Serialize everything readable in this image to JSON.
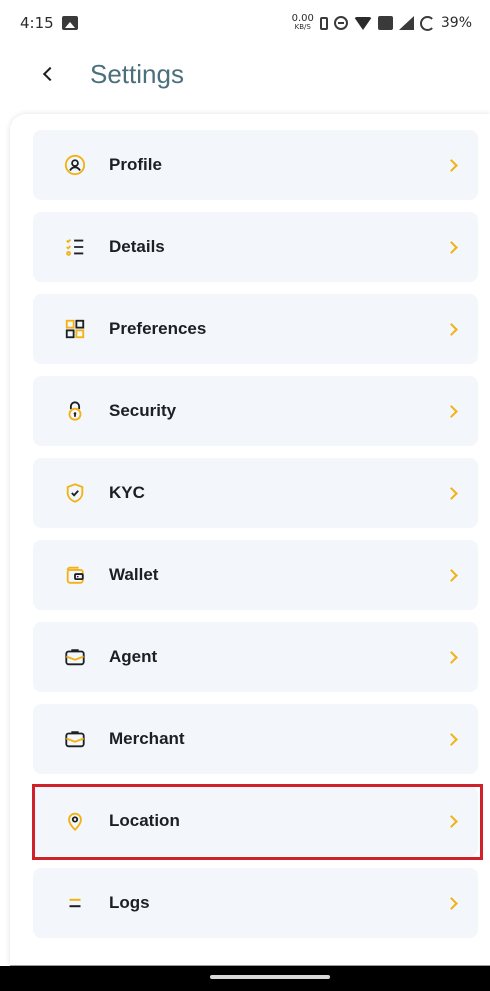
{
  "status_bar": {
    "time": "4:15",
    "net_speed": "0.00",
    "net_unit": "KB/S",
    "battery": "39%"
  },
  "header": {
    "title": "Settings"
  },
  "colors": {
    "accent": "#f2b212",
    "item_background": "#f3f6fa",
    "title": "#4c6f7c",
    "highlight": "#d0202a"
  },
  "settings": {
    "items": [
      {
        "label": "Profile",
        "icon": "profile-icon"
      },
      {
        "label": "Details",
        "icon": "details-list-icon"
      },
      {
        "label": "Preferences",
        "icon": "preferences-grid-icon"
      },
      {
        "label": "Security",
        "icon": "lock-icon"
      },
      {
        "label": "KYC",
        "icon": "shield-check-icon"
      },
      {
        "label": "Wallet",
        "icon": "wallet-icon"
      },
      {
        "label": "Agent",
        "icon": "agent-briefcase-icon"
      },
      {
        "label": "Merchant",
        "icon": "merchant-briefcase-icon"
      },
      {
        "label": "Location",
        "icon": "location-pin-icon",
        "highlighted": true
      },
      {
        "label": "Logs",
        "icon": "logs-icon"
      }
    ]
  }
}
